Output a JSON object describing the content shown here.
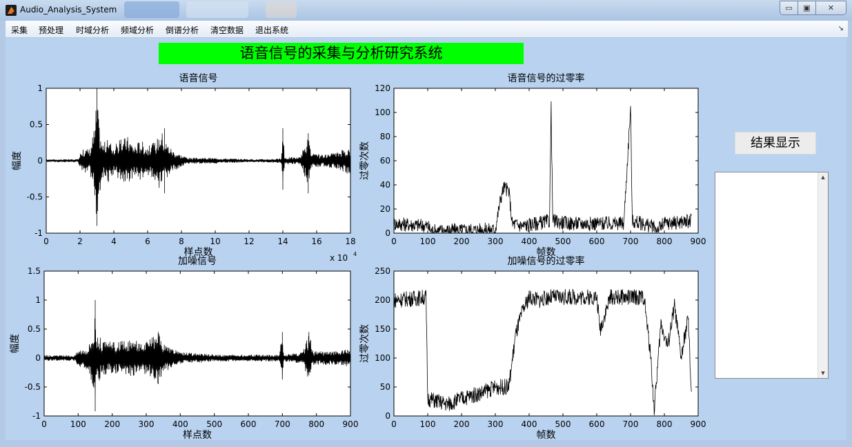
{
  "window": {
    "title": "Audio_Analysis_System",
    "buttons": [
      "▭",
      "▣",
      "✕"
    ]
  },
  "menu": [
    "采集",
    "预处理",
    "时域分析",
    "频域分析",
    "倒谱分析",
    "清空数据",
    "退出系统"
  ],
  "banner": "语音信号的采集与分析研究系统",
  "result_button": "结果显示",
  "colors": {
    "banner": "#00ff00",
    "figure_bg": "#b8d2f0",
    "plot_bg": "#ffffff",
    "trace": "#000000"
  },
  "chart_data": [
    {
      "type": "line",
      "title": "语音信号",
      "xlabel": "样点数",
      "ylabel": "幅度",
      "xlim": [
        0,
        18
      ],
      "ylim": [
        -1,
        1
      ],
      "x_ticks": [
        "0",
        "2",
        "4",
        "6",
        "8",
        "10",
        "12",
        "14",
        "16",
        "18"
      ],
      "y_ticks": [
        "-1",
        "-0.5",
        "0",
        "0.5",
        "1"
      ],
      "x_exponent": "x 10",
      "x_exponent_power": "4",
      "series": [
        {
          "envelope": [
            [
              0,
              0.02
            ],
            [
              1.9,
              0.02
            ],
            [
              2,
              0.15
            ],
            [
              2.6,
              0.18
            ],
            [
              2.9,
              0.55
            ],
            [
              3,
              1.0
            ],
            [
              3.1,
              0.6
            ],
            [
              3.3,
              0.25
            ],
            [
              3.7,
              0.3
            ],
            [
              4,
              0.2
            ],
            [
              4.3,
              0.28
            ],
            [
              4.8,
              0.35
            ],
            [
              5.2,
              0.22
            ],
            [
              5.6,
              0.3
            ],
            [
              6,
              0.2
            ],
            [
              6.5,
              0.28
            ],
            [
              6.8,
              0.45
            ],
            [
              7,
              0.3
            ],
            [
              7.5,
              0.15
            ],
            [
              8,
              0.08
            ],
            [
              8.5,
              0.04
            ],
            [
              10,
              0.04
            ],
            [
              11,
              0.03
            ],
            [
              12.5,
              0.02
            ],
            [
              13.9,
              0.03
            ],
            [
              14,
              0.45
            ],
            [
              14.1,
              0.05
            ],
            [
              15,
              0.05
            ],
            [
              15.5,
              0.35
            ],
            [
              15.7,
              0.1
            ],
            [
              16.5,
              0.08
            ],
            [
              17.2,
              0.12
            ],
            [
              17.7,
              0.18
            ]
          ],
          "peaks": [
            [
              3.0,
              1.0,
              -0.9
            ],
            [
              7.0,
              0.45,
              -0.45
            ],
            [
              14.0,
              0.45,
              -0.4
            ],
            [
              15.5,
              0.38,
              -0.45
            ]
          ]
        }
      ]
    },
    {
      "type": "line",
      "title": "语音信号的过零率",
      "xlabel": "帧数",
      "ylabel": "过零次数",
      "xlim": [
        0,
        900
      ],
      "ylim": [
        0,
        120
      ],
      "x_ticks": [
        "0",
        "100",
        "200",
        "300",
        "400",
        "500",
        "600",
        "700",
        "800",
        "900"
      ],
      "y_ticks": [
        "0",
        "20",
        "40",
        "60",
        "80",
        "100",
        "120"
      ],
      "series": [
        {
          "base": [
            [
              0,
              8
            ],
            [
              100,
              6
            ],
            [
              110,
              2
            ],
            [
              300,
              3
            ],
            [
              315,
              28
            ],
            [
              325,
              38
            ],
            [
              340,
              35
            ],
            [
              350,
              8
            ],
            [
              380,
              6
            ],
            [
              460,
              10
            ],
            [
              465,
              104
            ],
            [
              470,
              10
            ],
            [
              520,
              8
            ],
            [
              680,
              8
            ],
            [
              700,
              104
            ],
            [
              705,
              10
            ],
            [
              760,
              6
            ],
            [
              780,
              3
            ],
            [
              800,
              8
            ],
            [
              880,
              10
            ]
          ],
          "noise": 6
        }
      ]
    },
    {
      "type": "line",
      "title": "加噪信号",
      "xlabel": "样点数",
      "ylabel": "幅度",
      "xlim": [
        0,
        900
      ],
      "ylim": [
        -1,
        1.5
      ],
      "x_ticks": [
        "0",
        "100",
        "200",
        "300",
        "400",
        "500",
        "600",
        "700",
        "800",
        "900"
      ],
      "y_ticks": [
        "-1",
        "-0.5",
        "0",
        "0.5",
        "1",
        "1.5"
      ],
      "series": [
        {
          "envelope": [
            [
              0,
              0.05
            ],
            [
              90,
              0.05
            ],
            [
              100,
              0.15
            ],
            [
              130,
              0.2
            ],
            [
              148,
              0.6
            ],
            [
              150,
              1.0
            ],
            [
              152,
              0.5
            ],
            [
              170,
              0.3
            ],
            [
              190,
              0.28
            ],
            [
              240,
              0.3
            ],
            [
              270,
              0.32
            ],
            [
              300,
              0.28
            ],
            [
              335,
              0.45
            ],
            [
              350,
              0.25
            ],
            [
              400,
              0.1
            ],
            [
              460,
              0.08
            ],
            [
              500,
              0.06
            ],
            [
              690,
              0.06
            ],
            [
              700,
              0.45
            ],
            [
              705,
              0.06
            ],
            [
              760,
              0.1
            ],
            [
              778,
              0.45
            ],
            [
              790,
              0.12
            ],
            [
              860,
              0.12
            ],
            [
              880,
              0.15
            ]
          ],
          "peaks": [
            [
              150,
              1.0,
              -0.92
            ],
            [
              335,
              0.45,
              -0.45
            ],
            [
              700,
              0.45,
              -0.3
            ],
            [
              778,
              0.45,
              -0.3
            ]
          ]
        }
      ]
    },
    {
      "type": "line",
      "title": "加噪信号的过零率",
      "xlabel": "帧数",
      "ylabel": "过零次数",
      "xlim": [
        0,
        900
      ],
      "ylim": [
        0,
        250
      ],
      "x_ticks": [
        "0",
        "100",
        "200",
        "300",
        "400",
        "500",
        "600",
        "700",
        "800",
        "900"
      ],
      "y_ticks": [
        "0",
        "50",
        "100",
        "150",
        "200",
        "250"
      ],
      "series": [
        {
          "base": [
            [
              0,
              200
            ],
            [
              95,
              205
            ],
            [
              100,
              30
            ],
            [
              160,
              20
            ],
            [
              200,
              30
            ],
            [
              260,
              40
            ],
            [
              300,
              50
            ],
            [
              340,
              50
            ],
            [
              360,
              140
            ],
            [
              380,
              180
            ],
            [
              400,
              205
            ],
            [
              430,
              200
            ],
            [
              460,
              205
            ],
            [
              600,
              205
            ],
            [
              610,
              150
            ],
            [
              640,
              205
            ],
            [
              740,
              205
            ],
            [
              760,
              100
            ],
            [
              770,
              10
            ],
            [
              790,
              160
            ],
            [
              810,
              120
            ],
            [
              830,
              190
            ],
            [
              850,
              100
            ],
            [
              870,
              170
            ],
            [
              880,
              40
            ]
          ],
          "noise": 14
        }
      ]
    }
  ]
}
